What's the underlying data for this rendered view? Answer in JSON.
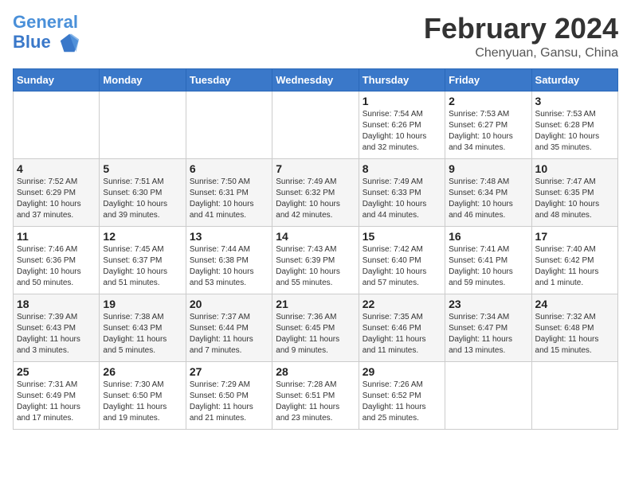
{
  "header": {
    "logo_line1": "General",
    "logo_line2": "Blue",
    "month_title": "February 2024",
    "subtitle": "Chenyuan, Gansu, China"
  },
  "days_of_week": [
    "Sunday",
    "Monday",
    "Tuesday",
    "Wednesday",
    "Thursday",
    "Friday",
    "Saturday"
  ],
  "weeks": [
    [
      {
        "day": "",
        "info": ""
      },
      {
        "day": "",
        "info": ""
      },
      {
        "day": "",
        "info": ""
      },
      {
        "day": "",
        "info": ""
      },
      {
        "day": "1",
        "info": "Sunrise: 7:54 AM\nSunset: 6:26 PM\nDaylight: 10 hours\nand 32 minutes."
      },
      {
        "day": "2",
        "info": "Sunrise: 7:53 AM\nSunset: 6:27 PM\nDaylight: 10 hours\nand 34 minutes."
      },
      {
        "day": "3",
        "info": "Sunrise: 7:53 AM\nSunset: 6:28 PM\nDaylight: 10 hours\nand 35 minutes."
      }
    ],
    [
      {
        "day": "4",
        "info": "Sunrise: 7:52 AM\nSunset: 6:29 PM\nDaylight: 10 hours\nand 37 minutes."
      },
      {
        "day": "5",
        "info": "Sunrise: 7:51 AM\nSunset: 6:30 PM\nDaylight: 10 hours\nand 39 minutes."
      },
      {
        "day": "6",
        "info": "Sunrise: 7:50 AM\nSunset: 6:31 PM\nDaylight: 10 hours\nand 41 minutes."
      },
      {
        "day": "7",
        "info": "Sunrise: 7:49 AM\nSunset: 6:32 PM\nDaylight: 10 hours\nand 42 minutes."
      },
      {
        "day": "8",
        "info": "Sunrise: 7:49 AM\nSunset: 6:33 PM\nDaylight: 10 hours\nand 44 minutes."
      },
      {
        "day": "9",
        "info": "Sunrise: 7:48 AM\nSunset: 6:34 PM\nDaylight: 10 hours\nand 46 minutes."
      },
      {
        "day": "10",
        "info": "Sunrise: 7:47 AM\nSunset: 6:35 PM\nDaylight: 10 hours\nand 48 minutes."
      }
    ],
    [
      {
        "day": "11",
        "info": "Sunrise: 7:46 AM\nSunset: 6:36 PM\nDaylight: 10 hours\nand 50 minutes."
      },
      {
        "day": "12",
        "info": "Sunrise: 7:45 AM\nSunset: 6:37 PM\nDaylight: 10 hours\nand 51 minutes."
      },
      {
        "day": "13",
        "info": "Sunrise: 7:44 AM\nSunset: 6:38 PM\nDaylight: 10 hours\nand 53 minutes."
      },
      {
        "day": "14",
        "info": "Sunrise: 7:43 AM\nSunset: 6:39 PM\nDaylight: 10 hours\nand 55 minutes."
      },
      {
        "day": "15",
        "info": "Sunrise: 7:42 AM\nSunset: 6:40 PM\nDaylight: 10 hours\nand 57 minutes."
      },
      {
        "day": "16",
        "info": "Sunrise: 7:41 AM\nSunset: 6:41 PM\nDaylight: 10 hours\nand 59 minutes."
      },
      {
        "day": "17",
        "info": "Sunrise: 7:40 AM\nSunset: 6:42 PM\nDaylight: 11 hours\nand 1 minute."
      }
    ],
    [
      {
        "day": "18",
        "info": "Sunrise: 7:39 AM\nSunset: 6:43 PM\nDaylight: 11 hours\nand 3 minutes."
      },
      {
        "day": "19",
        "info": "Sunrise: 7:38 AM\nSunset: 6:43 PM\nDaylight: 11 hours\nand 5 minutes."
      },
      {
        "day": "20",
        "info": "Sunrise: 7:37 AM\nSunset: 6:44 PM\nDaylight: 11 hours\nand 7 minutes."
      },
      {
        "day": "21",
        "info": "Sunrise: 7:36 AM\nSunset: 6:45 PM\nDaylight: 11 hours\nand 9 minutes."
      },
      {
        "day": "22",
        "info": "Sunrise: 7:35 AM\nSunset: 6:46 PM\nDaylight: 11 hours\nand 11 minutes."
      },
      {
        "day": "23",
        "info": "Sunrise: 7:34 AM\nSunset: 6:47 PM\nDaylight: 11 hours\nand 13 minutes."
      },
      {
        "day": "24",
        "info": "Sunrise: 7:32 AM\nSunset: 6:48 PM\nDaylight: 11 hours\nand 15 minutes."
      }
    ],
    [
      {
        "day": "25",
        "info": "Sunrise: 7:31 AM\nSunset: 6:49 PM\nDaylight: 11 hours\nand 17 minutes."
      },
      {
        "day": "26",
        "info": "Sunrise: 7:30 AM\nSunset: 6:50 PM\nDaylight: 11 hours\nand 19 minutes."
      },
      {
        "day": "27",
        "info": "Sunrise: 7:29 AM\nSunset: 6:50 PM\nDaylight: 11 hours\nand 21 minutes."
      },
      {
        "day": "28",
        "info": "Sunrise: 7:28 AM\nSunset: 6:51 PM\nDaylight: 11 hours\nand 23 minutes."
      },
      {
        "day": "29",
        "info": "Sunrise: 7:26 AM\nSunset: 6:52 PM\nDaylight: 11 hours\nand 25 minutes."
      },
      {
        "day": "",
        "info": ""
      },
      {
        "day": "",
        "info": ""
      }
    ]
  ]
}
